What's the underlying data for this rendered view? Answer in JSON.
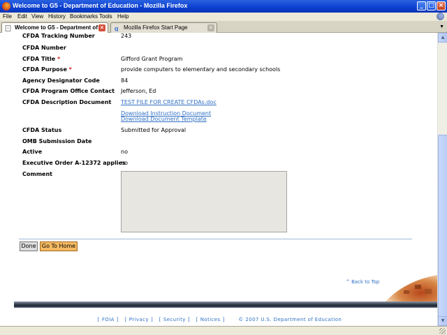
{
  "window": {
    "title": "Welcome to G5 - Department of Education - Mozilla Firefox",
    "minimize": "_",
    "maximize": "□",
    "close": "×"
  },
  "menu": [
    "File",
    "Edit",
    "View",
    "History",
    "Bookmarks",
    "Tools",
    "Help"
  ],
  "tabs": [
    {
      "label": "Welcome to G5 - Department of ...",
      "active": true
    },
    {
      "label": "Mozilla Firefox Start Page",
      "active": false
    }
  ],
  "fields": [
    {
      "label": "CFDA Tracking Number",
      "value": "243",
      "required": false
    },
    {
      "label": "CFDA Number",
      "value": "",
      "required": false
    },
    {
      "label": "CFDA Title",
      "value": "Gifford Grant Program",
      "required": true
    },
    {
      "label": "CFDA Purpose",
      "value": "provide computers to elementary and secondary schools",
      "required": true
    },
    {
      "label": "Agency Designator Code",
      "value": "84",
      "required": false
    },
    {
      "label": "CFDA Program Office Contact",
      "value": "Jefferson, Ed",
      "required": false
    }
  ],
  "description_document": {
    "label": "CFDA Description Document",
    "file_link": "TEST FILE FOR CREATE CFDAs.doc",
    "download_instruction": "Download Instruction Document",
    "download_template": "Download Document Template"
  },
  "fields2": [
    {
      "label": "CFDA Status",
      "value": "Submitted for Approval"
    },
    {
      "label": "OMB Submission Date",
      "value": ""
    },
    {
      "label": "Active",
      "value": "no"
    },
    {
      "label": "Executive Order A-12372 applies",
      "value": "no"
    }
  ],
  "comment": {
    "label": "Comment",
    "value": ""
  },
  "required_marker": "*",
  "buttons": {
    "done": "Done",
    "home": "Go To Home"
  },
  "back_to_top": "^ Back to Top",
  "footer": {
    "links": [
      "FOIA",
      "Privacy",
      "Security",
      "Notices"
    ],
    "copyright": "© 2007 U.S. Department of Education"
  },
  "colors": {
    "link": "#2f6fc4",
    "required": "#d02020",
    "home_button": "#f4b962"
  }
}
